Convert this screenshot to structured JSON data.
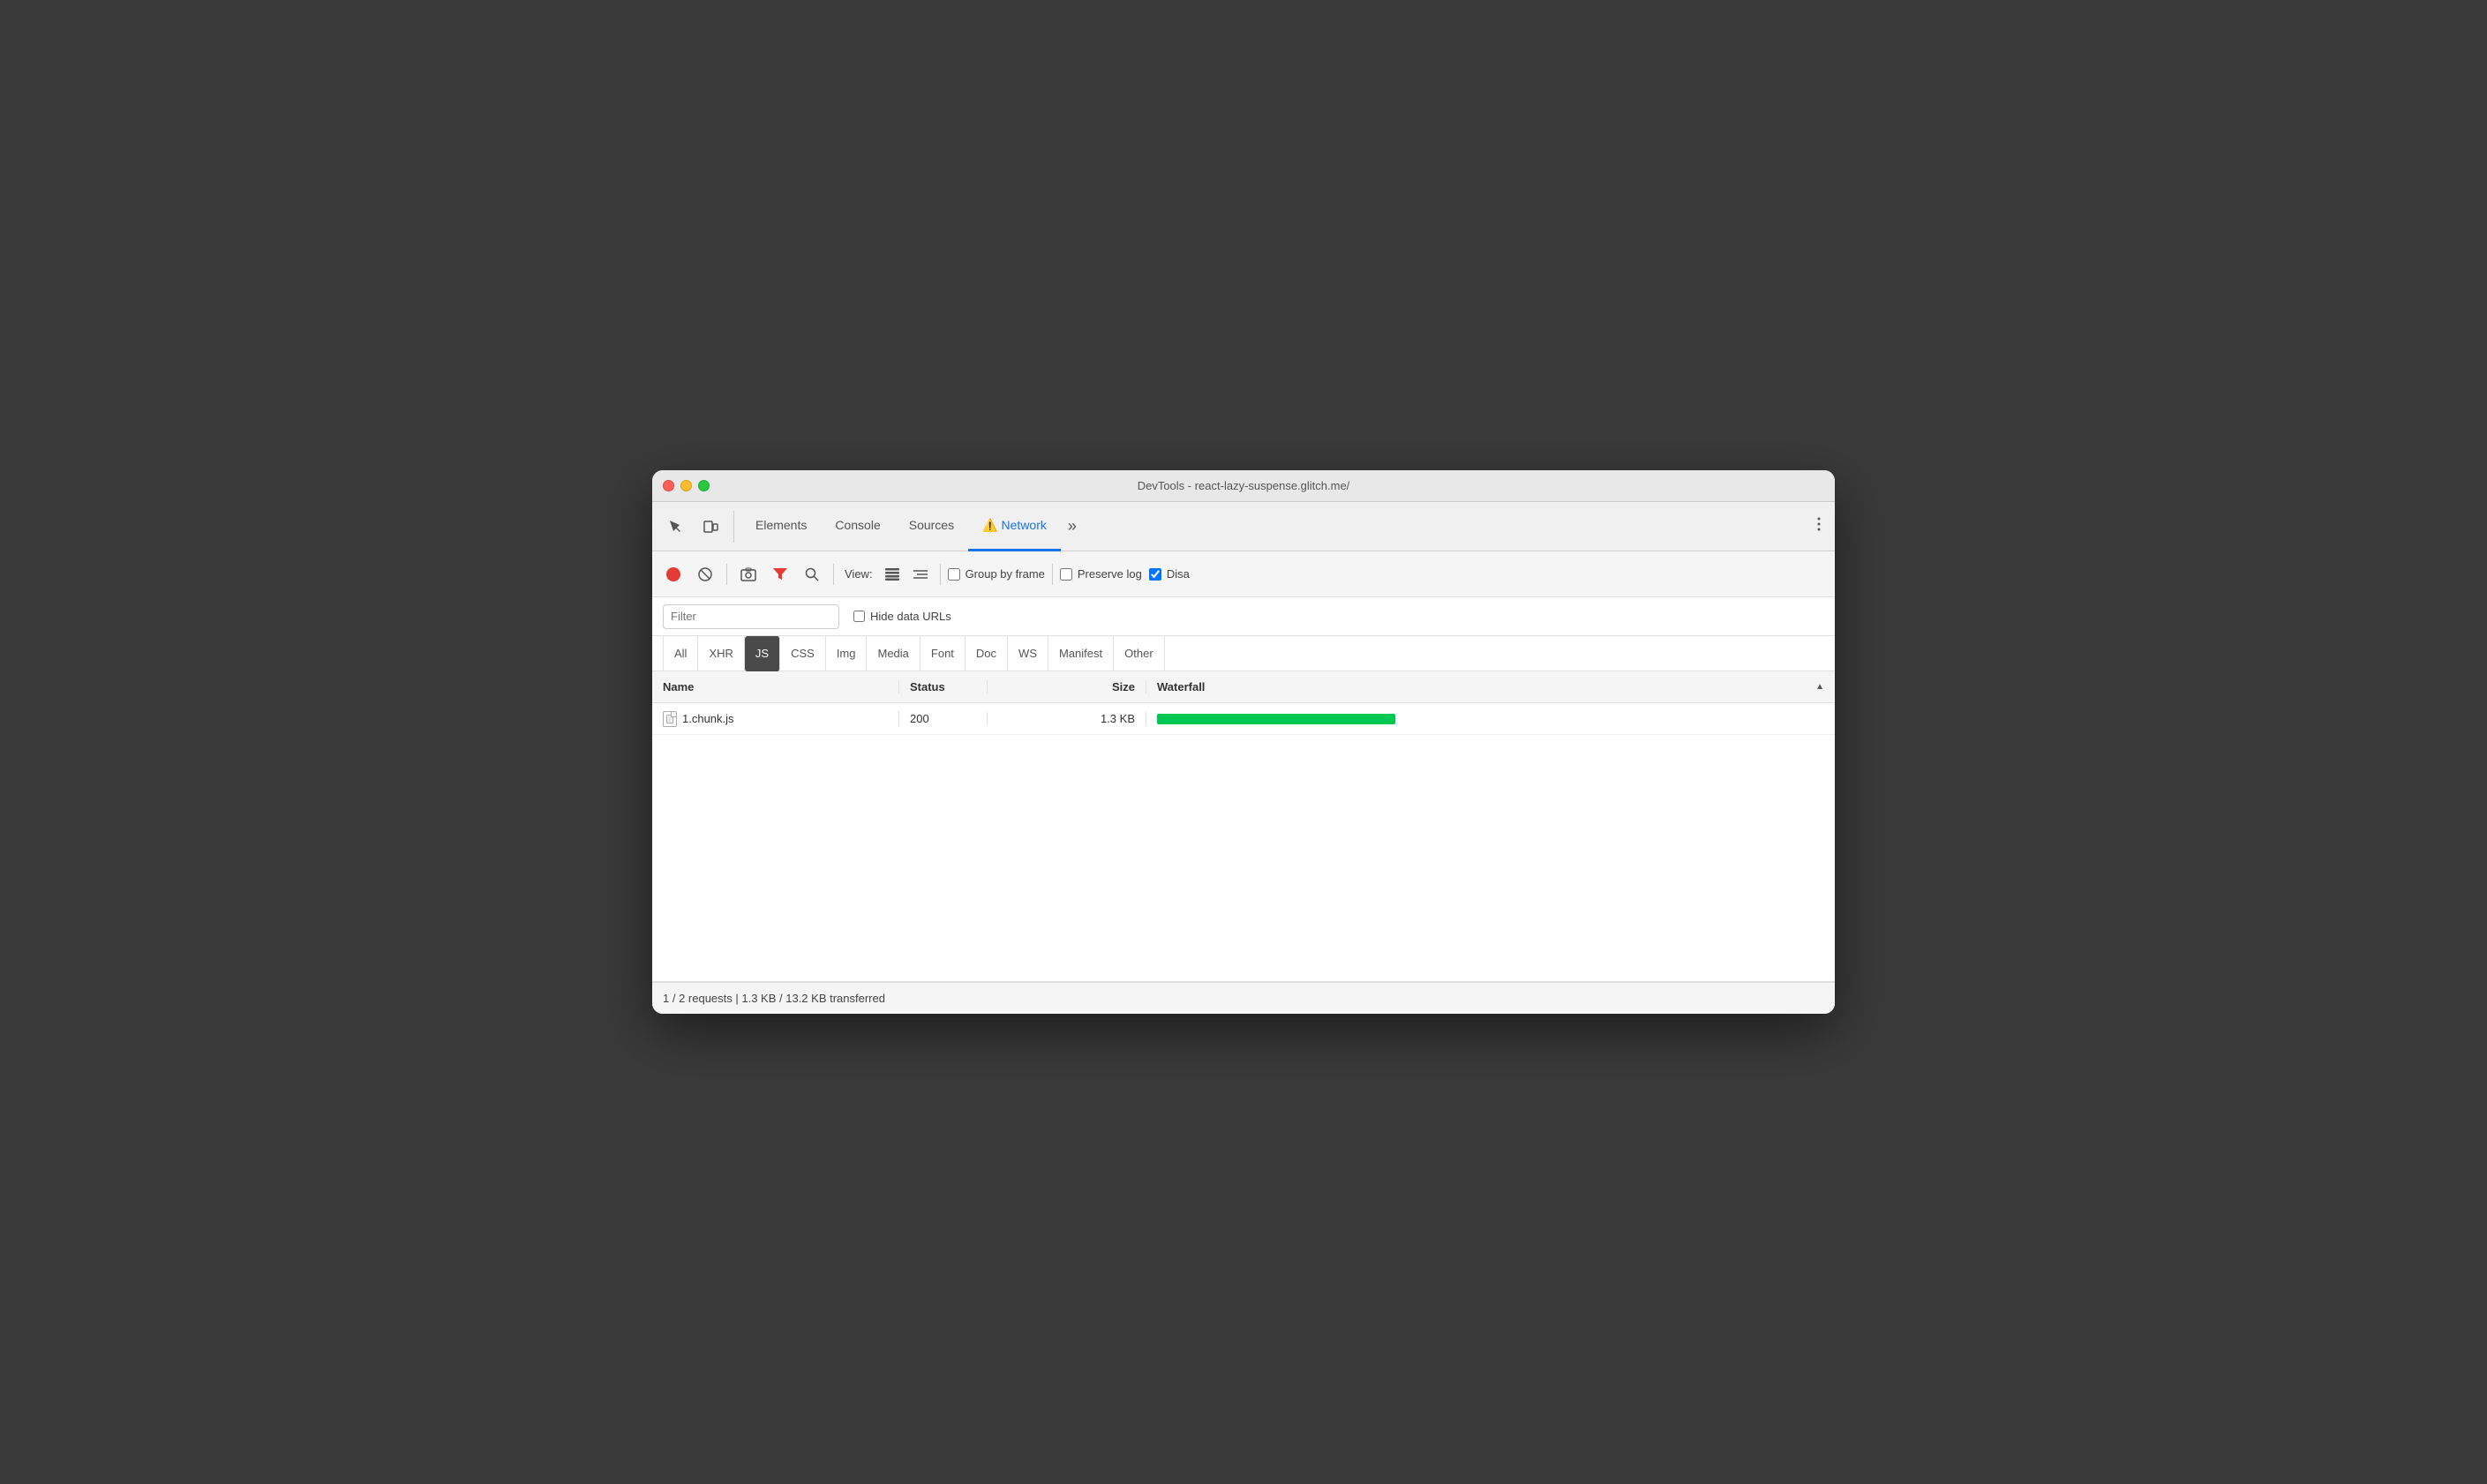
{
  "window": {
    "title": "DevTools - react-lazy-suspense.glitch.me/"
  },
  "traffic_lights": {
    "close": "close",
    "minimize": "minimize",
    "maximize": "maximize"
  },
  "tabs": [
    {
      "id": "elements",
      "label": "Elements",
      "icon": ""
    },
    {
      "id": "console",
      "label": "Console",
      "icon": ""
    },
    {
      "id": "sources",
      "label": "Sources",
      "icon": ""
    },
    {
      "id": "network",
      "label": "Network",
      "icon": "⚠️",
      "active": true
    },
    {
      "id": "more",
      "label": "»",
      "icon": ""
    }
  ],
  "toolbar": {
    "record_label": "Record",
    "clear_label": "Clear",
    "screenshot_label": "Screenshot",
    "filter_label": "Filter",
    "search_label": "Search",
    "view_label": "View:",
    "group_by_frame_label": "Group by frame",
    "preserve_log_label": "Preserve log",
    "disable_cache_label": "Disa",
    "preserve_log_checked": false,
    "disable_cache_checked": true
  },
  "filter_bar": {
    "filter_placeholder": "Filter",
    "hide_data_urls_label": "Hide data URLs",
    "hide_data_urls_checked": false
  },
  "type_filters": [
    {
      "id": "all",
      "label": "All"
    },
    {
      "id": "xhr",
      "label": "XHR"
    },
    {
      "id": "js",
      "label": "JS",
      "active": true
    },
    {
      "id": "css",
      "label": "CSS"
    },
    {
      "id": "img",
      "label": "Img"
    },
    {
      "id": "media",
      "label": "Media"
    },
    {
      "id": "font",
      "label": "Font"
    },
    {
      "id": "doc",
      "label": "Doc"
    },
    {
      "id": "ws",
      "label": "WS"
    },
    {
      "id": "manifest",
      "label": "Manifest"
    },
    {
      "id": "other",
      "label": "Other"
    }
  ],
  "table": {
    "columns": [
      {
        "id": "name",
        "label": "Name"
      },
      {
        "id": "status",
        "label": "Status"
      },
      {
        "id": "size",
        "label": "Size"
      },
      {
        "id": "waterfall",
        "label": "Waterfall"
      }
    ],
    "rows": [
      {
        "name": "1.chunk.js",
        "status": "200",
        "size": "1.3 KB",
        "waterfall_width": 270
      }
    ]
  },
  "status_bar": {
    "text": "1 / 2 requests | 1.3 KB / 13.2 KB transferred"
  },
  "colors": {
    "active_tab": "#1a73e8",
    "waterfall_bar": "#00c853",
    "record_red": "#e53935",
    "filter_red": "#e53935"
  }
}
